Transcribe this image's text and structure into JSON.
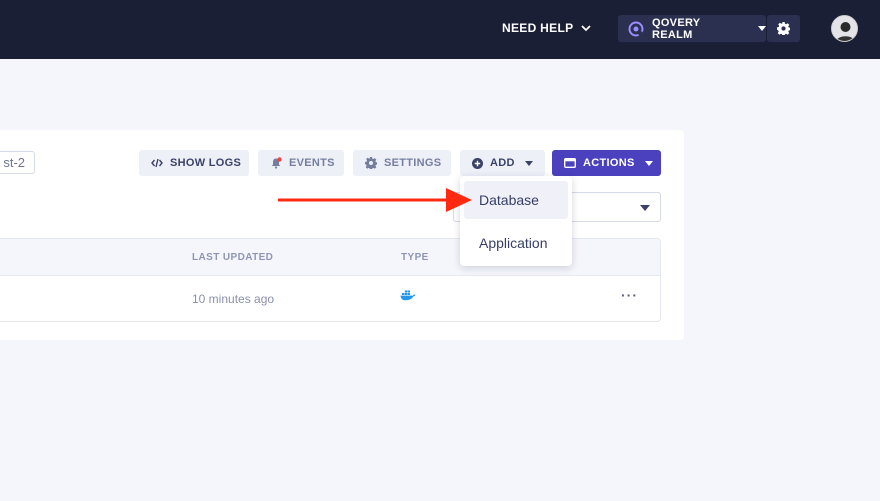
{
  "topbar": {
    "need_help": "NEED HELP",
    "realm_name": "QOVERY REALM"
  },
  "panel": {
    "tag_text": "st-2"
  },
  "toolbar": {
    "show_logs": "SHOW LOGS",
    "events": "EVENTS",
    "settings": "SETTINGS",
    "add": "ADD",
    "actions": "ACTIONS"
  },
  "add_menu": {
    "items": [
      {
        "label": "Database"
      },
      {
        "label": "Application"
      }
    ]
  },
  "table": {
    "columns": [
      "LAST UPDATED",
      "TYPE"
    ],
    "rows": [
      {
        "last_updated": "10 minutes ago",
        "type_icon": "docker-icon",
        "more": "···"
      }
    ]
  },
  "colors": {
    "topbar_bg": "#1b1f35",
    "accent": "#4b40bd",
    "arrow": "#ff2a0f",
    "events_dot": "#ef4444",
    "docker": "#2496ed"
  }
}
